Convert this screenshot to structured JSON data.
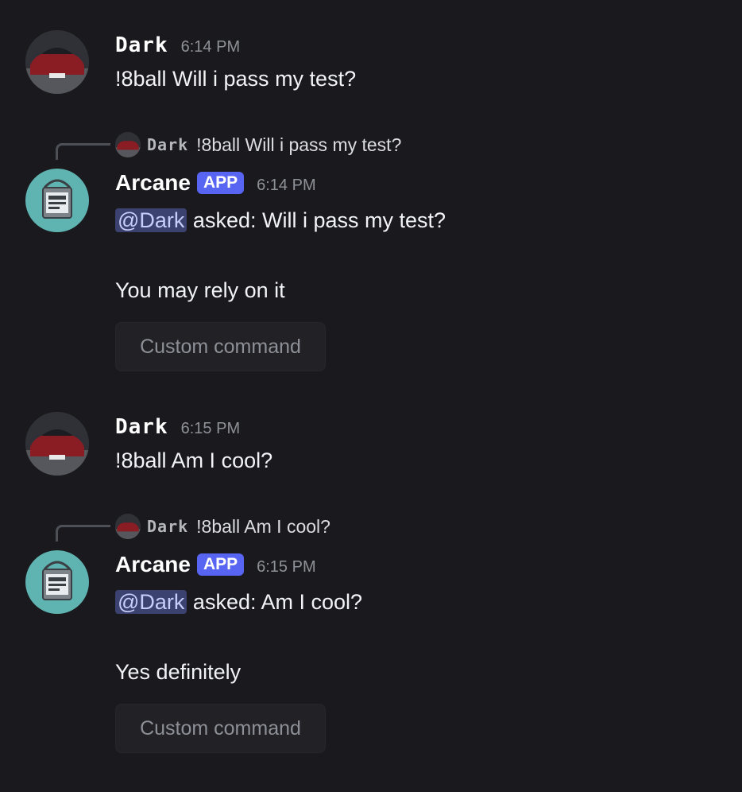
{
  "messages": [
    {
      "author": "Dark",
      "time": "6:14 PM",
      "text": "!8ball Will i pass my test?"
    },
    {
      "reply": {
        "author": "Dark",
        "text": "!8ball Will i pass my test?"
      },
      "author": "Arcane",
      "badge": "APP",
      "time": "6:14 PM",
      "mention": "@Dark",
      "asked": " asked: Will i pass my test?",
      "answer": "You may rely on it",
      "button_label": "Custom command"
    },
    {
      "author": "Dark",
      "time": "6:15 PM",
      "text": "!8ball Am I cool?"
    },
    {
      "reply": {
        "author": "Dark",
        "text": "!8ball Am I cool?"
      },
      "author": "Arcane",
      "badge": "APP",
      "time": "6:15 PM",
      "mention": "@Dark",
      "asked": " asked: Am I cool?",
      "answer": "Yes definitely",
      "button_label": "Custom command"
    }
  ],
  "icons": {
    "dark_avatar": "red-car-avatar-icon",
    "arcane_avatar": "paint-bucket-avatar-icon"
  },
  "colors": {
    "background": "#1a1a1e",
    "app_badge": "#5865f2",
    "mention_bg": "#3c4270",
    "mention_text": "#c9cdfb",
    "arcane_avatar_bg": "#5fb3b0"
  }
}
